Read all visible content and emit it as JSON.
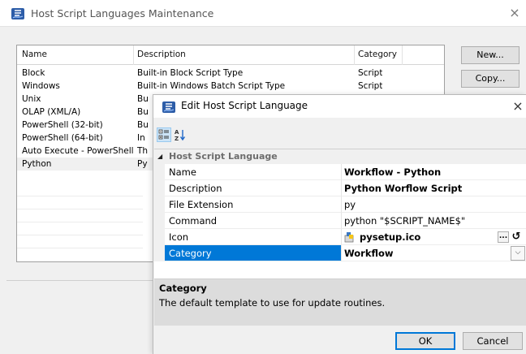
{
  "bg_window": {
    "title": "Host Script Languages Maintenance",
    "close_glyph": "×",
    "columns": [
      "Name",
      "Description",
      "Category"
    ],
    "rows": [
      {
        "name": "Block",
        "description": "Built-in Block Script Type",
        "category": "Script"
      },
      {
        "name": "Windows",
        "description": "Built-in Windows Batch Script Type",
        "category": "Script"
      },
      {
        "name": "Unix",
        "description": "Bu",
        "category": ""
      },
      {
        "name": "OLAP (XML/A)",
        "description": "Bu",
        "category": ""
      },
      {
        "name": "PowerShell (32-bit)",
        "description": "Bu",
        "category": ""
      },
      {
        "name": "PowerShell (64-bit)",
        "description": "In",
        "category": ""
      },
      {
        "name": "Auto Execute - PowerShell",
        "description": "Th",
        "category": ""
      },
      {
        "name": "Python",
        "description": "Py",
        "category": ""
      }
    ],
    "buttons": {
      "new": "New...",
      "copy": "Copy..."
    }
  },
  "dialog": {
    "title": "Edit Host Script Language",
    "close_glyph": "×",
    "toolbar": {
      "categorized_icon": "categorized-view-icon",
      "alphabetical_icon": "sort-az-icon",
      "alphabetical_glyph": "A↓"
    },
    "category_header": "Host Script Language",
    "properties": [
      {
        "name": "Name",
        "value": "Workflow - Python"
      },
      {
        "name": "Description",
        "value": "Python Worflow Script"
      },
      {
        "name": "File Extension",
        "value": "py"
      },
      {
        "name": "Command",
        "value": "python \"$SCRIPT_NAME$\""
      },
      {
        "name": "Icon",
        "value": "pysetup.ico"
      },
      {
        "name": "Category",
        "value": "Workflow"
      }
    ],
    "icon_ellipsis": "...",
    "icon_reset": "↺",
    "dropdown_glyph": "⌵",
    "help": {
      "title": "Category",
      "text": "The default template to use for update routines."
    },
    "ok_label": "OK",
    "cancel_label": "Cancel"
  },
  "colors": {
    "selection": "#0078d7",
    "accent": "#cce4f7"
  }
}
